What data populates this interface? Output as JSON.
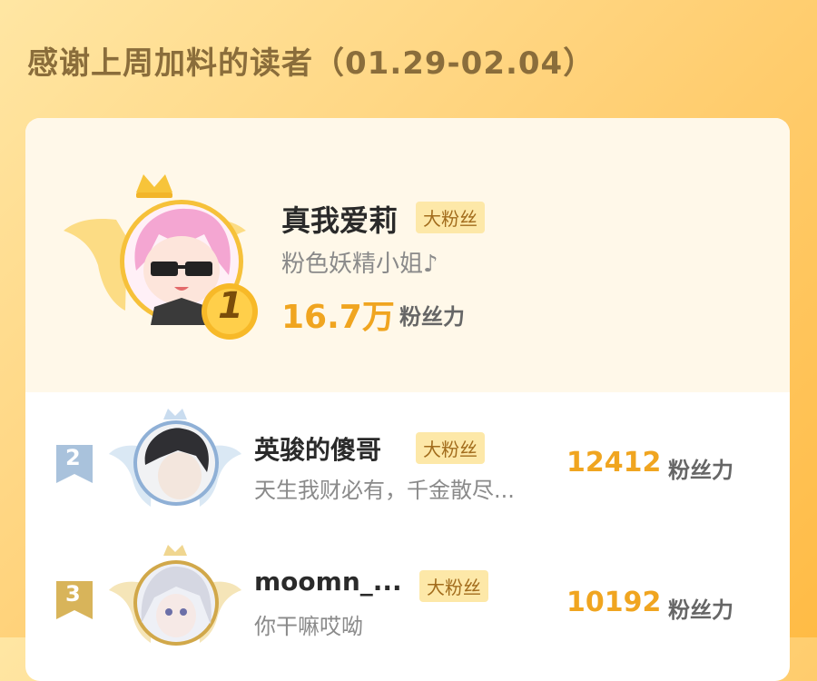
{
  "header": {
    "title": "感谢上周加料的读者（01.29-02.04）"
  },
  "leaderboard": [
    {
      "rank": "1",
      "name": "真我爱莉",
      "badge": "大粉丝",
      "signature": "粉色妖精小姐♪",
      "score": "16.7万",
      "score_unit": "粉丝力"
    },
    {
      "rank": "2",
      "name": "英骏的傻哥",
      "badge": "大粉丝",
      "signature": "天生我财必有，千金散尽...",
      "score": "12412",
      "score_unit": "粉丝力"
    },
    {
      "rank": "3",
      "name": "moomn_...",
      "badge": "大粉丝",
      "signature": "你干嘛哎呦",
      "score": "10192",
      "score_unit": "粉丝力"
    }
  ],
  "colors": {
    "gold": "#f0a520",
    "badge_bg": "#fde8a8",
    "silver": "#a9c2dc",
    "bronze": "#d8b45a"
  }
}
